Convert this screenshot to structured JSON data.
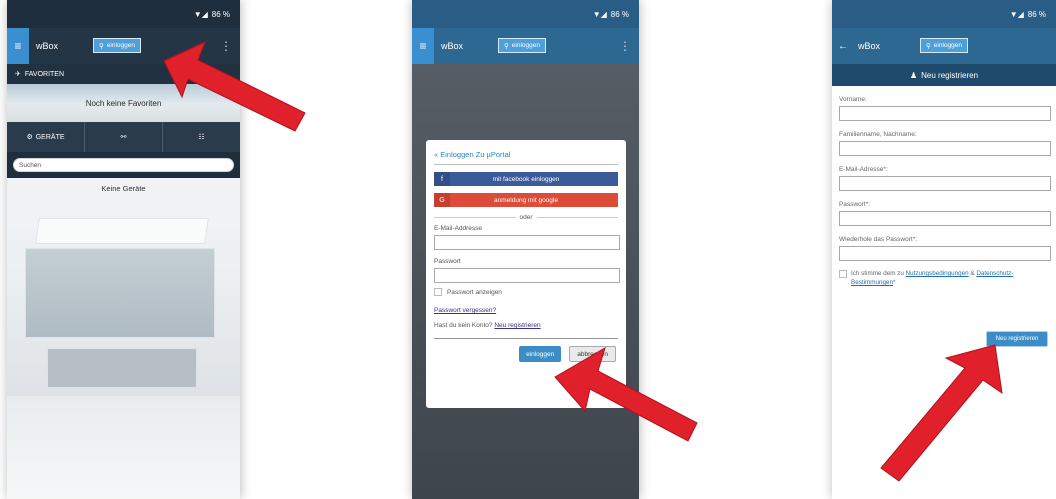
{
  "status_bar": {
    "icons": "▼◢",
    "battery": "86 %"
  },
  "app_brand": "wBox",
  "login_chip": {
    "icon": "key-icon",
    "label": "einloggen"
  },
  "screen1": {
    "favorites_header": "FAVORITEN",
    "favorites_empty": "Noch keine Favoriten",
    "tabs": [
      {
        "label": "GERÄTE",
        "icon": "gear-icon"
      },
      {
        "label": "",
        "icon": "link-icon"
      },
      {
        "label": "",
        "icon": "sliders-icon"
      }
    ],
    "search_placeholder": "Suchen",
    "devices_empty": "Keine Geräte"
  },
  "screen2": {
    "dialog_title": "« Einloggen Zu µPortal",
    "facebook_label": "mit facebook einloggen",
    "facebook_icon": "f",
    "google_label": "anmeldung mit google",
    "google_icon": "G",
    "or_label": "oder",
    "email_label": "E-Mail-Addresse",
    "password_label": "Passwort",
    "show_password_label": "Passwort anzeigen",
    "forgot_password": "Passwort vergessen?",
    "no_account_text": "Hast du kein Konto?",
    "register_link": "Neu registrieren",
    "login_button": "einloggen",
    "cancel_button": "abbrechen"
  },
  "screen3": {
    "header": "Neu registrieren",
    "header_icon": "user-icon",
    "fields": [
      {
        "label": "Vorname:"
      },
      {
        "label": "Familienname, Nachname:"
      },
      {
        "label": "E-Mail-Adresse*:"
      },
      {
        "label": "Passwort*:"
      },
      {
        "label": "Wiederhole das Passwort*:"
      }
    ],
    "agree_prefix": "Ich stimme dem zu",
    "terms_link": "Nutzungsbedingungen",
    "agree_and": "&",
    "privacy_link": "Datenschutz-Bestimmungen",
    "agree_suffix": "*",
    "register_button": "Neu registrieren"
  },
  "colors": {
    "arrow": "#e0202a",
    "primary": "#3c8dc5",
    "facebook": "#3b5a9a",
    "google": "#dd4b39"
  }
}
